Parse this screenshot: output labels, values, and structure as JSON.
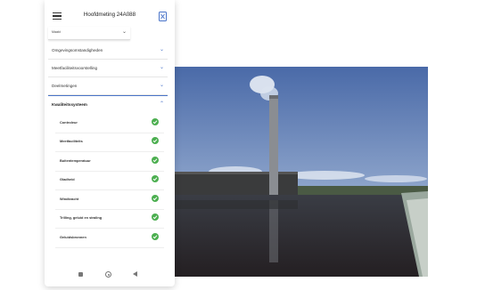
{
  "appbar": {
    "title": "Hoofdmeting 24A088",
    "menu_icon": "menu-icon",
    "export_icon": "excel-export-icon"
  },
  "select": {
    "value": "Maakt"
  },
  "sections": [
    {
      "label": "Omgevingsomstandigheden",
      "state": "collapsed"
    },
    {
      "label": "Meetfaciliteitsvoorstelling",
      "state": "collapsed"
    },
    {
      "label": "Deelmetingen",
      "state": "collapsed"
    },
    {
      "label": "Kwaliteitssysteem",
      "state": "expanded"
    }
  ],
  "quality_items": [
    {
      "label": "Controleur",
      "status": "ok"
    },
    {
      "label": "Meetfaciliteits",
      "status": "ok"
    },
    {
      "label": "Buitentemperatuur",
      "status": "ok"
    },
    {
      "label": "Gladheid",
      "status": "ok"
    },
    {
      "label": "Windkracht",
      "status": "ok"
    },
    {
      "label": "Trilling, geluid en straling",
      "status": "ok"
    },
    {
      "label": "Geluidsbronnen",
      "status": "ok"
    }
  ],
  "colors": {
    "accent": "#4a74c9",
    "check": "#4caf50"
  },
  "navbar": {
    "icons": [
      "recent-apps-icon",
      "home-icon",
      "back-icon"
    ]
  }
}
